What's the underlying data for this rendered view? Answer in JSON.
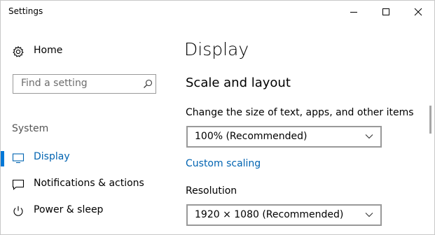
{
  "window": {
    "title": "Settings",
    "controls": [
      "minimize-icon",
      "maximize-icon",
      "close-icon"
    ]
  },
  "sidebar": {
    "home_label": "Home",
    "home_icon": "gear-icon",
    "search": {
      "placeholder": "Find a setting",
      "icon": "search-icon"
    },
    "section_label": "System",
    "items": [
      {
        "label": "Display",
        "icon": "monitor-icon",
        "selected": true
      },
      {
        "label": "Notifications & actions",
        "icon": "message-icon",
        "selected": false
      },
      {
        "label": "Power & sleep",
        "icon": "power-icon",
        "selected": false
      }
    ]
  },
  "main": {
    "title": "Display",
    "section_title": "Scale and layout",
    "scale": {
      "label": "Change the size of text, apps, and other items",
      "value": "100% (Recommended)"
    },
    "custom_scaling_link": "Custom scaling",
    "resolution": {
      "label": "Resolution",
      "value": "1920 × 1080 (Recommended)"
    }
  },
  "colors": {
    "accent": "#0078d7",
    "link": "#0063b1",
    "border": "#999999"
  }
}
